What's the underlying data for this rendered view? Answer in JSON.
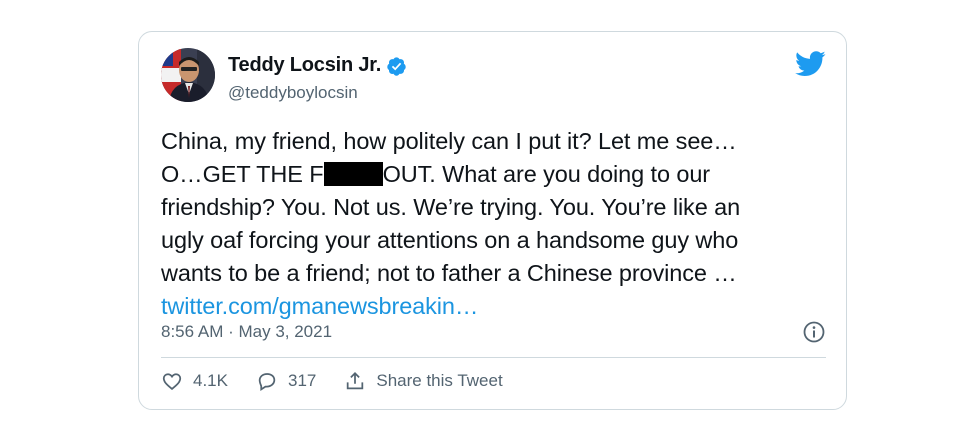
{
  "tweet": {
    "author_name": "Teddy Locsin Jr.",
    "author_handle": "@teddyboylocsin",
    "verified_icon": "verified-badge-icon",
    "brand_icon": "twitter-bird-icon",
    "text": {
      "line1": "China, my friend, how politely can I put it? Let me see…",
      "line2_before": "O…GET THE F",
      "line2_after": "OUT. What are you doing to our",
      "line3": "friendship? You. Not us. We’re trying. You. You’re like an",
      "line4": "ugly oaf forcing your attentions on a handsome guy who",
      "line5": "wants to be a friend; not to father a Chinese province …",
      "link": "twitter.com/gmanewsbreakin…"
    },
    "timestamp": "8:56 AM · May 3, 2021",
    "actions": {
      "like_count": "4.1K",
      "reply_count": "317",
      "share_label": "Share this Tweet"
    },
    "colors": {
      "accent": "#1d9bf0",
      "link": "#1b95e0",
      "secondary_text": "#536471",
      "border": "#cfd9de"
    }
  }
}
